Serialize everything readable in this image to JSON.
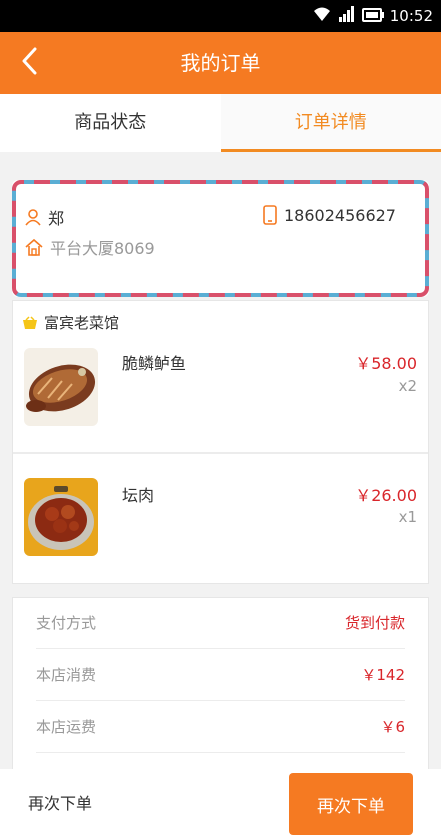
{
  "status_bar": {
    "time": "10:52",
    "icons": [
      "wifi-icon",
      "signal-icon",
      "battery-icon"
    ]
  },
  "header": {
    "title": "我的订单",
    "back_icon": "chevron-left-icon"
  },
  "tabs": [
    {
      "label": "商品状态",
      "active": false
    },
    {
      "label": "订单详情",
      "active": true
    }
  ],
  "address": {
    "name": "郑",
    "phone": "18602456627",
    "address": "平台大厦8069"
  },
  "shop": {
    "name": "富宾老菜馆",
    "icon": "basket-icon"
  },
  "items": [
    {
      "name": "脆鳞鲈鱼",
      "price": "￥58.00",
      "qty": "x2"
    },
    {
      "name": "坛肉",
      "price": "￥26.00",
      "qty": "x1"
    }
  ],
  "summary": [
    {
      "label": "支付方式",
      "value": "货到付款"
    },
    {
      "label": "本店消费",
      "value": "￥142"
    },
    {
      "label": "本店运费",
      "value": "￥6"
    }
  ],
  "footer": {
    "reorder_text": "再次下单",
    "reorder_button": "再次下单"
  },
  "colors": {
    "accent": "#f57a22",
    "price": "#d9262b",
    "envelope_red": "#d9506a",
    "envelope_blue": "#5aaed4"
  }
}
